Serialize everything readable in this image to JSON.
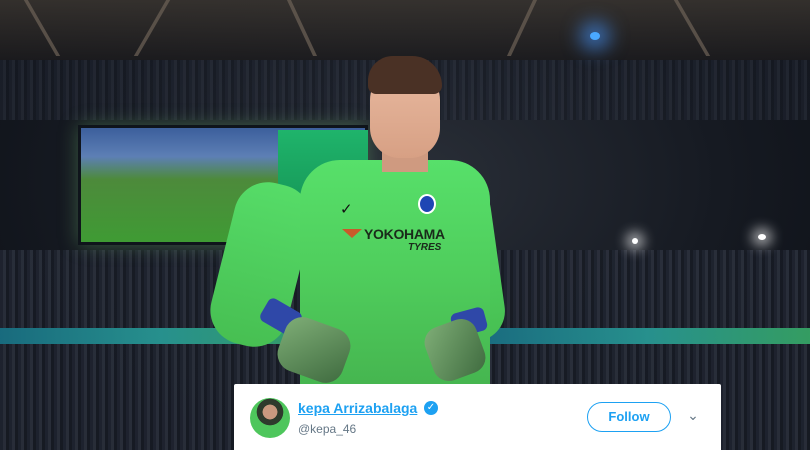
{
  "image": {
    "jersey_sponsor": "YOKOHAMA",
    "jersey_sponsor_sub": "TYRES"
  },
  "tweet": {
    "display_name": "kepa Arrizabalaga",
    "handle": "@kepa_46",
    "follow_label": "Follow",
    "verified_icon": "verified-badge-icon",
    "menu_icon": "chevron-down-icon",
    "accent_color": "#1da1f2"
  }
}
